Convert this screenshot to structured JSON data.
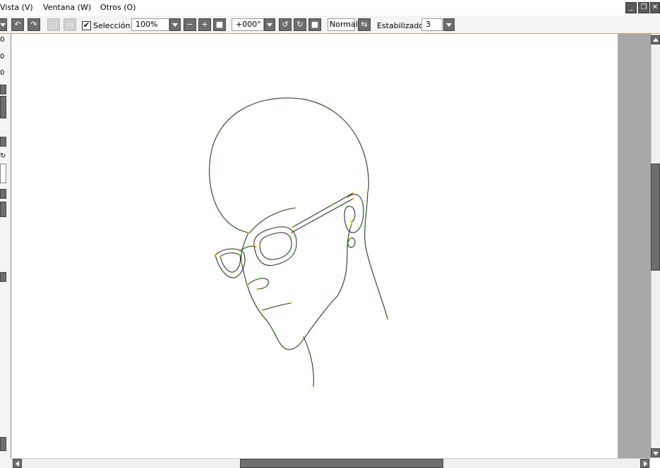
{
  "menubar": {
    "items": [
      "Vista (V)",
      "Ventana (W)",
      "Otros (O)"
    ]
  },
  "window_controls": {
    "minimize": "_",
    "restore": "❐",
    "close": "✕"
  },
  "toolbar": {
    "selection_label": "Selección",
    "selection_checked": true,
    "zoom_value": "100%",
    "rotation_value": "+000°",
    "view_mode_label": "Normal",
    "stabilizer_label": "Estabilizador",
    "stabilizer_value": "3"
  },
  "left_panel": {
    "values": [
      "0",
      "0",
      "0"
    ]
  },
  "drawing": {
    "stroke_color": "#333333",
    "control_point_colors": [
      "#3ccf1e",
      "#f0a500"
    ]
  }
}
